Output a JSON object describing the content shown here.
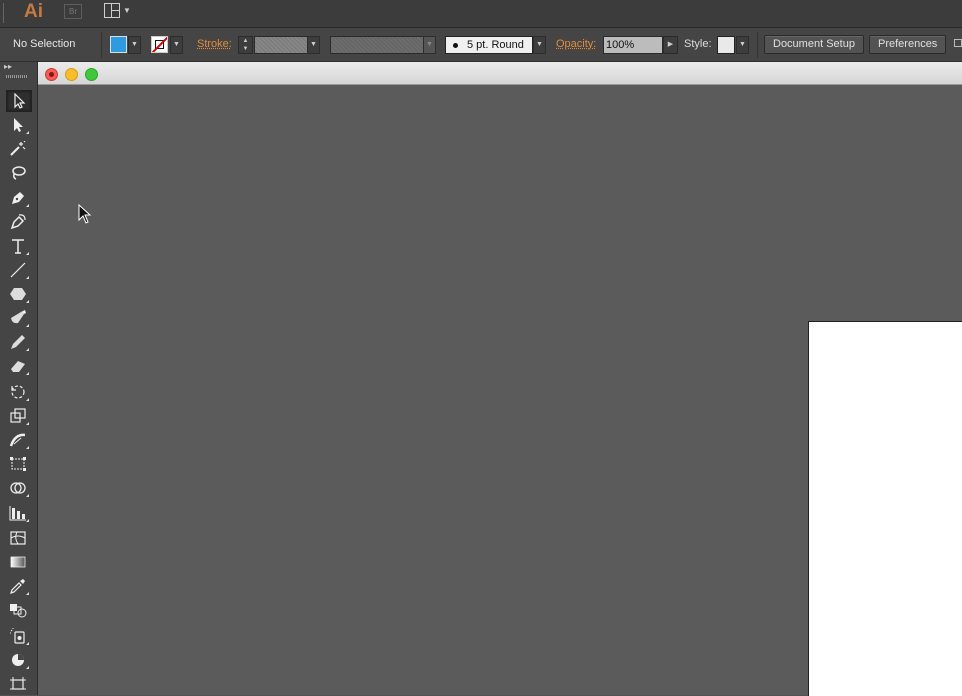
{
  "app": {
    "logo": "Ai",
    "bridge_label": "Br"
  },
  "control_bar": {
    "selection_label": "No Selection",
    "stroke_label": "Stroke:",
    "brush_label": "5 pt. Round",
    "opacity_label": "Opacity:",
    "opacity_value": "100%",
    "style_label": "Style:",
    "document_setup_label": "Document Setup",
    "preferences_label": "Preferences"
  },
  "colors": {
    "fill": "#2e9be0",
    "stroke": "none",
    "accent_label": "#e38c3a",
    "canvas": "#5b5b5b",
    "artboard": "#ffffff"
  },
  "tools": [
    {
      "icon": "selection-icon"
    },
    {
      "icon": "direct-selection-icon"
    },
    {
      "icon": "magic-wand-icon"
    },
    {
      "icon": "lasso-icon"
    },
    {
      "icon": "pen-icon"
    },
    {
      "icon": "curvature-icon"
    },
    {
      "icon": "type-icon"
    },
    {
      "icon": "line-segment-icon"
    },
    {
      "icon": "polygon-icon"
    },
    {
      "icon": "paintbrush-icon"
    },
    {
      "icon": "pencil-icon"
    },
    {
      "icon": "eraser-icon"
    },
    {
      "icon": "rotate-icon"
    },
    {
      "icon": "scale-icon"
    },
    {
      "icon": "width-icon"
    },
    {
      "icon": "free-transform-icon"
    },
    {
      "icon": "shape-builder-icon"
    },
    {
      "icon": "graph-icon"
    },
    {
      "icon": "mesh-icon"
    },
    {
      "icon": "gradient-icon"
    },
    {
      "icon": "eyedropper-icon"
    },
    {
      "icon": "blend-icon"
    },
    {
      "icon": "symbol-sprayer-icon"
    },
    {
      "icon": "slice-icon"
    },
    {
      "icon": "artboard-icon"
    }
  ]
}
